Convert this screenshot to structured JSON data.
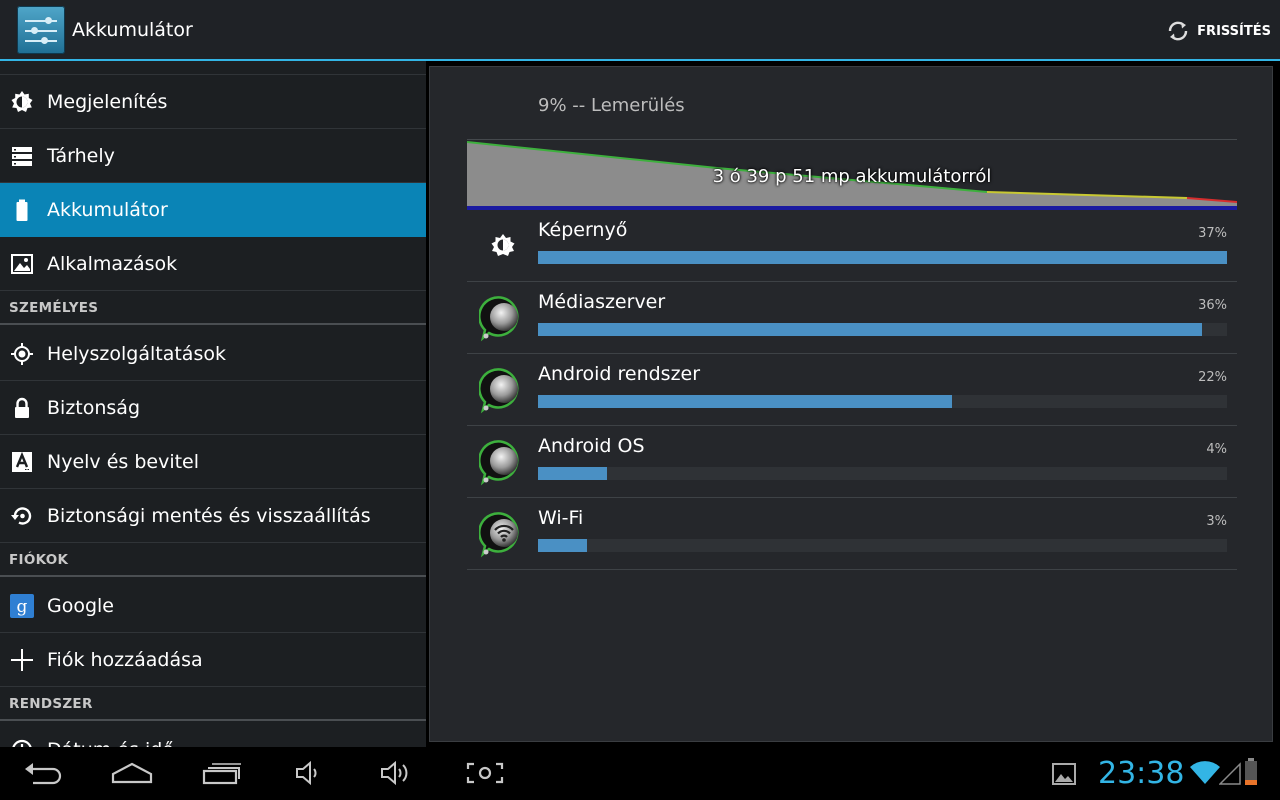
{
  "actionbar": {
    "title": "Akkumulátor",
    "refresh_label": "FRISSÍTÉS",
    "app_icon": "settings-sliders-icon",
    "refresh_icon": "refresh-icon"
  },
  "sidebar": {
    "items_top": [
      {
        "label": "Megjelenítés",
        "icon": "brightness-icon"
      },
      {
        "label": "Tárhely",
        "icon": "storage-icon"
      },
      {
        "label": "Akkumulátor",
        "icon": "battery-icon",
        "selected": true
      },
      {
        "label": "Alkalmazások",
        "icon": "apps-icon"
      }
    ],
    "header_personal": "SZEMÉLYES",
    "items_personal": [
      {
        "label": "Helyszolgáltatások",
        "icon": "location-icon"
      },
      {
        "label": "Biztonság",
        "icon": "lock-icon"
      },
      {
        "label": "Nyelv és bevitel",
        "icon": "language-icon"
      },
      {
        "label": "Biztonsági mentés és visszaállítás",
        "icon": "backup-icon"
      }
    ],
    "header_accounts": "FIÓKOK",
    "items_accounts": [
      {
        "label": "Google",
        "icon": "google-icon"
      },
      {
        "label": "Fiók hozzáadása",
        "icon": "plus-icon"
      }
    ],
    "header_system": "RENDSZER",
    "items_system": [
      {
        "label": "Dátum és idő",
        "icon": "clock-icon"
      }
    ]
  },
  "battery": {
    "headline": "9% -- Lemerülés",
    "graph_label": "3 ó 39 p 51 mp akkumulátorról",
    "colors": {
      "fill": "#8c8c8c",
      "good": "#3db03d",
      "mid": "#c8c832",
      "low": "#d62d2d",
      "baseline": "#1a1aa0"
    },
    "usage": [
      {
        "name": "Képernyő",
        "percent_label": "37%",
        "fraction": 1.0,
        "icon": "brightness-icon"
      },
      {
        "name": "Médiaszerver",
        "percent_label": "36%",
        "fraction": 0.963,
        "icon": "android-app-icon"
      },
      {
        "name": "Android rendszer",
        "percent_label": "22%",
        "fraction": 0.601,
        "icon": "android-app-icon"
      },
      {
        "name": "Android OS",
        "percent_label": "4%",
        "fraction": 0.1,
        "icon": "android-app-icon"
      },
      {
        "name": "Wi-Fi",
        "percent_label": "3%",
        "fraction": 0.071,
        "icon": "wifi-app-icon"
      }
    ],
    "bar_color": "#4a90c4"
  },
  "navbar": {
    "clock": "23:38",
    "accent": "#33b5e5",
    "buttons": [
      "back-icon",
      "home-icon",
      "recent-apps-icon",
      "volume-down-icon",
      "volume-up-icon",
      "screenshot-icon"
    ],
    "status_icons": [
      "gallery-icon",
      "wifi-signal-icon",
      "cell-signal-icon",
      "battery-low-icon"
    ]
  }
}
